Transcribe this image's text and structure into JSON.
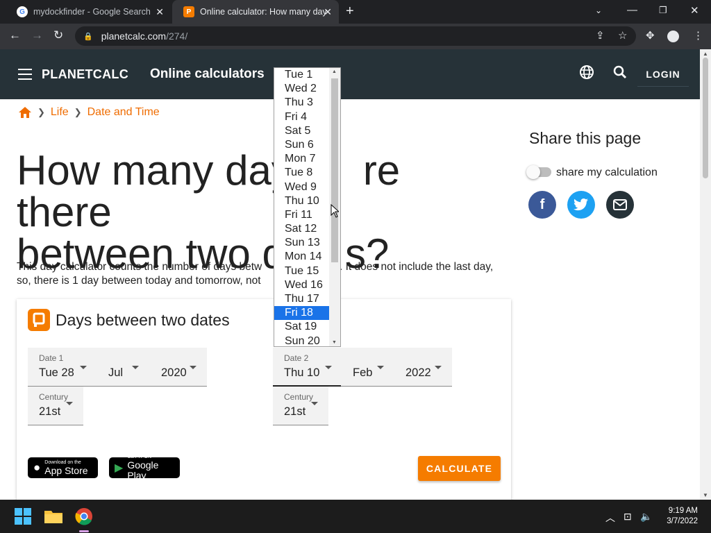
{
  "browser": {
    "tabs": [
      {
        "title": "mydockfinder - Google Search"
      },
      {
        "title": "Online calculator: How many day"
      }
    ],
    "new_tab": "+",
    "url_host": "planetcalc.com",
    "url_path": "/274/"
  },
  "site": {
    "brand": "PLANETCALC",
    "nav_link": "Online calculators",
    "login": "LOGIN"
  },
  "breadcrumb": [
    "Life",
    "Date and Time"
  ],
  "page": {
    "title": "How many days are there between two dates?",
    "title_line1": "How many day",
    "title_line1_end": "re there",
    "title_line2": "between two d",
    "title_line2_end": "s?",
    "desc_line1": "This day calculator counts the number of days betw",
    "desc_line1_end": "s. It does not include the last day,",
    "desc_line2": "so, there is 1 day between today and tomorrow, not"
  },
  "calculator": {
    "title": "Days between two dates",
    "date1": {
      "label": "Date 1",
      "day": "Tue 28",
      "month": "Jul",
      "year": "2020"
    },
    "century1": {
      "label": "Century",
      "value": "21st"
    },
    "date2": {
      "label": "Date 2",
      "day": "Thu 10",
      "month": "Feb",
      "year": "2022"
    },
    "century2": {
      "label": "Century",
      "value": "21st"
    },
    "appstore": {
      "small": "Download on the",
      "big": "App Store"
    },
    "googleplay": {
      "small": "GET IT ON",
      "big": "Google Play"
    },
    "calculate": "CALCULATE"
  },
  "share": {
    "title": "Share this page",
    "toggle_label": "share my calculation"
  },
  "dropdown": {
    "options": [
      "Tue 1",
      "Wed 2",
      "Thu 3",
      "Fri 4",
      "Sat 5",
      "Sun 6",
      "Mon 7",
      "Tue 8",
      "Wed 9",
      "Thu 10",
      "Fri 11",
      "Sat 12",
      "Sun 13",
      "Mon 14",
      "Tue 15",
      "Wed 16",
      "Thu 17",
      "Fri 18",
      "Sat 19",
      "Sun 20"
    ],
    "highlighted": "Fri 18"
  },
  "taskbar": {
    "time": "9:19 AM",
    "date": "3/7/2022"
  },
  "colors": {
    "accent": "#f57c00",
    "appbar": "#263238",
    "facebook": "#3b5998",
    "twitter": "#1da1f2",
    "email": "#263238"
  }
}
